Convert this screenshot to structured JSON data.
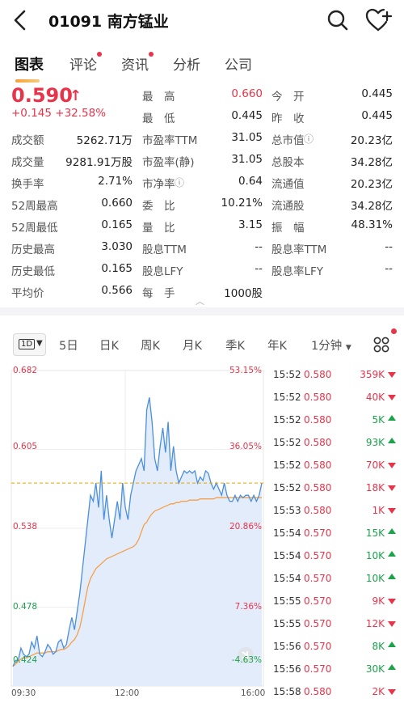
{
  "header": {
    "title": "01091 南方锰业"
  },
  "tabs": [
    {
      "label": "图表",
      "active": true,
      "dot": false
    },
    {
      "label": "评论",
      "active": false,
      "dot": true
    },
    {
      "label": "资讯",
      "active": false,
      "dot": true
    },
    {
      "label": "分析",
      "active": false,
      "dot": false
    },
    {
      "label": "公司",
      "active": false,
      "dot": false
    }
  ],
  "quote": {
    "price": "0.590",
    "change": "+0.145",
    "change_pct": "+32.58%",
    "rows": [
      [
        {
          "l": "最　高",
          "v": "0.660",
          "red": true
        },
        {
          "l": "今　开",
          "v": "0.445"
        }
      ],
      [
        {
          "l": "最　低",
          "v": "0.445"
        },
        {
          "l": "昨　收",
          "v": "0.445"
        }
      ],
      [
        {
          "l": "成交额",
          "v": "5262.71万"
        },
        {
          "l": "市盈率TTM",
          "v": "31.05"
        },
        {
          "l": "总市值",
          "v": "20.23亿",
          "info": true
        }
      ],
      [
        {
          "l": "成交量",
          "v": "9281.91万股"
        },
        {
          "l": "市盈率(静)",
          "v": "31.05"
        },
        {
          "l": "总股本",
          "v": "34.28亿"
        }
      ],
      [
        {
          "l": "换手率",
          "v": "2.71%"
        },
        {
          "l": "市净率",
          "v": "0.64",
          "info": true
        },
        {
          "l": "流通值",
          "v": "20.23亿"
        }
      ],
      [
        {
          "l": "52周最高",
          "v": "0.660"
        },
        {
          "l": "委　比",
          "v": "10.21%"
        },
        {
          "l": "流通股",
          "v": "34.28亿"
        }
      ],
      [
        {
          "l": "52周最低",
          "v": "0.165"
        },
        {
          "l": "量　比",
          "v": "3.15"
        },
        {
          "l": "振　幅",
          "v": "48.31%"
        }
      ],
      [
        {
          "l": "历史最高",
          "v": "3.030"
        },
        {
          "l": "股息TTM",
          "v": "--"
        },
        {
          "l": "股息率TTM",
          "v": "--"
        }
      ],
      [
        {
          "l": "历史最低",
          "v": "0.165"
        },
        {
          "l": "股息LFY",
          "v": "--"
        },
        {
          "l": "股息率LFY",
          "v": "--"
        }
      ],
      [
        {
          "l": "平均价",
          "v": "0.566"
        },
        {
          "l": "每　手",
          "v": "1000股"
        }
      ]
    ]
  },
  "chart_toolbar": {
    "period_selected": "1D",
    "items": [
      "5日",
      "日K",
      "周K",
      "月K",
      "季K",
      "年K",
      "1分钟"
    ]
  },
  "chart_data": {
    "type": "line",
    "price_ticks": [
      "0.682",
      "0.605",
      "0.538",
      "0.478",
      "0.424"
    ],
    "pct_ticks": [
      "53.15%",
      "36.05%",
      "20.86%",
      "7.36%",
      "-4.63%"
    ],
    "time_ticks": [
      "09:30",
      "12:00",
      "16:00"
    ],
    "ylim": [
      0.424,
      0.682
    ],
    "prev_close_line": 0.59,
    "series": [
      {
        "name": "",
        "values": [
          0.44,
          0.445,
          0.445,
          0.455,
          0.45,
          0.448,
          0.45,
          0.46,
          0.455,
          0.465,
          0.45,
          0.448,
          0.452,
          0.458,
          0.455,
          0.45,
          0.452,
          0.46,
          0.462,
          0.455,
          0.458,
          0.47,
          0.48,
          0.47,
          0.485,
          0.5,
          0.52,
          0.54,
          0.56,
          0.58,
          0.575,
          0.59,
          0.57,
          0.6,
          0.56,
          0.58,
          0.56,
          0.545,
          0.56,
          0.575,
          0.56,
          0.59,
          0.57,
          0.56,
          0.58,
          0.59,
          0.6,
          0.605,
          0.61,
          0.6,
          0.65,
          0.66,
          0.64,
          0.61,
          0.6,
          0.62,
          0.635,
          0.615,
          0.64,
          0.6,
          0.62,
          0.6,
          0.59,
          0.595,
          0.6,
          0.598,
          0.6,
          0.598,
          0.6,
          0.59,
          0.595,
          0.592,
          0.6,
          0.598,
          0.59,
          0.585,
          0.59,
          0.585,
          0.58,
          0.59,
          0.58,
          0.575,
          0.575,
          0.58,
          0.575,
          0.58,
          0.578,
          0.58,
          0.58,
          0.575,
          0.58,
          0.575,
          0.58,
          0.59
        ]
      },
      {
        "name": "",
        "values": [
          0.44,
          0.442,
          0.444,
          0.446,
          0.447,
          0.447,
          0.448,
          0.449,
          0.45,
          0.451,
          0.451,
          0.451,
          0.451,
          0.452,
          0.452,
          0.452,
          0.452,
          0.453,
          0.454,
          0.454,
          0.455,
          0.457,
          0.46,
          0.462,
          0.466,
          0.472,
          0.482,
          0.494,
          0.505,
          0.512,
          0.516,
          0.52,
          0.522,
          0.524,
          0.526,
          0.528,
          0.529,
          0.53,
          0.531,
          0.532,
          0.533,
          0.534,
          0.535,
          0.536,
          0.537,
          0.538,
          0.54,
          0.544,
          0.55,
          0.556,
          0.558,
          0.562,
          0.565,
          0.567,
          0.568,
          0.569,
          0.57,
          0.571,
          0.572,
          0.573,
          0.573,
          0.574,
          0.574,
          0.575,
          0.575,
          0.575,
          0.576,
          0.576,
          0.576,
          0.576,
          0.577,
          0.577,
          0.577,
          0.577,
          0.577,
          0.577,
          0.578,
          0.578,
          0.578,
          0.578,
          0.578,
          0.578,
          0.578,
          0.578,
          0.578,
          0.578,
          0.578,
          0.578,
          0.578,
          0.578,
          0.578,
          0.578,
          0.578,
          0.578
        ]
      }
    ]
  },
  "trades": [
    {
      "t": "15:52",
      "p": "0.580",
      "v": "359K",
      "dir": "down"
    },
    {
      "t": "15:52",
      "p": "0.580",
      "v": "40K",
      "dir": "down"
    },
    {
      "t": "15:52",
      "p": "0.580",
      "v": "5K",
      "dir": "up"
    },
    {
      "t": "15:52",
      "p": "0.580",
      "v": "93K",
      "dir": "up"
    },
    {
      "t": "15:52",
      "p": "0.580",
      "v": "70K",
      "dir": "down"
    },
    {
      "t": "15:52",
      "p": "0.580",
      "v": "18K",
      "dir": "down"
    },
    {
      "t": "15:53",
      "p": "0.580",
      "v": "1K",
      "dir": "down"
    },
    {
      "t": "15:54",
      "p": "0.570",
      "v": "15K",
      "dir": "up"
    },
    {
      "t": "15:54",
      "p": "0.570",
      "v": "10K",
      "dir": "up"
    },
    {
      "t": "15:54",
      "p": "0.570",
      "v": "10K",
      "dir": "up"
    },
    {
      "t": "15:55",
      "p": "0.570",
      "v": "9K",
      "dir": "down"
    },
    {
      "t": "15:55",
      "p": "0.570",
      "v": "12K",
      "dir": "down"
    },
    {
      "t": "15:56",
      "p": "0.570",
      "v": "8K",
      "dir": "up"
    },
    {
      "t": "15:56",
      "p": "0.570",
      "v": "30K",
      "dir": "up"
    },
    {
      "t": "15:58",
      "p": "0.580",
      "v": "2K",
      "dir": "down"
    }
  ],
  "colors": {
    "red": "#e8344a",
    "green": "#1aa34a",
    "line": "#4a8fdc",
    "avg": "#f5a04a"
  },
  "icons": [
    "back-arrow-icon",
    "search-icon",
    "favorite-add-icon",
    "grid-icon",
    "info-icon",
    "exit-icon"
  ]
}
